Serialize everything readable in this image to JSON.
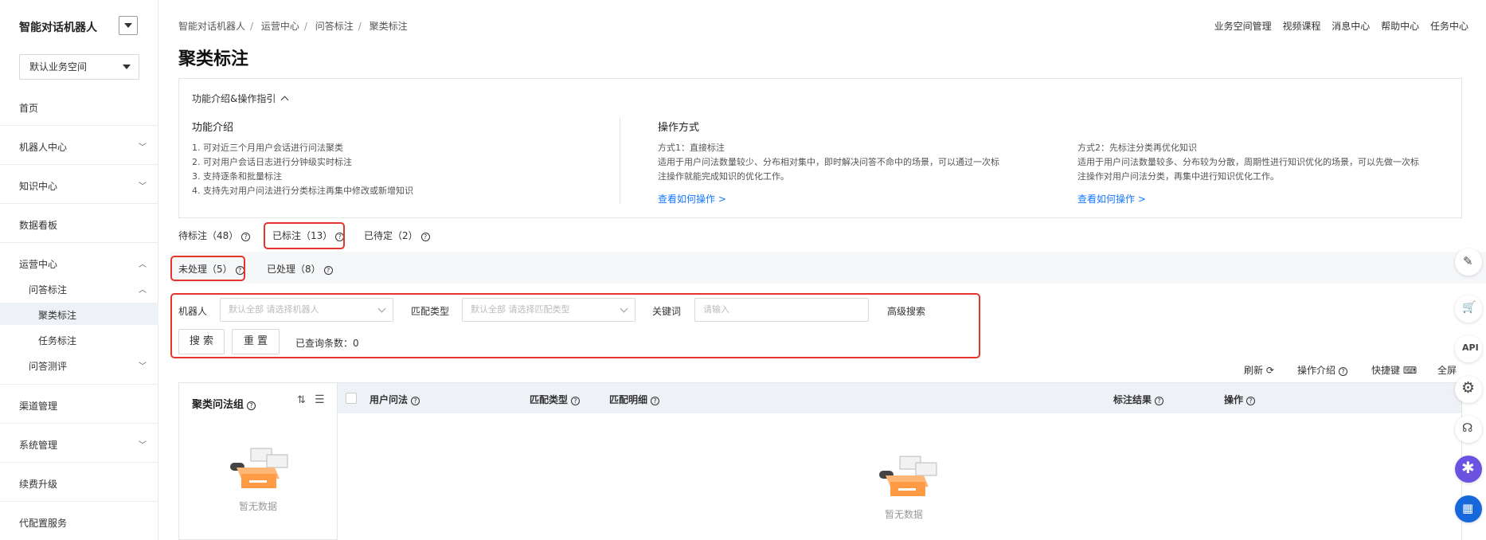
{
  "app": {
    "title": "智能对话机器人",
    "workspace": "默认业务空间"
  },
  "sidebar": {
    "items": [
      {
        "label": "首页"
      },
      {
        "label": "机器人中心"
      },
      {
        "label": "知识中心"
      },
      {
        "label": "数据看板"
      },
      {
        "label": "运营中心"
      },
      {
        "label": "问答标注"
      },
      {
        "label": "聚类标注"
      },
      {
        "label": "任务标注"
      },
      {
        "label": "问答测评"
      },
      {
        "label": "渠道管理"
      },
      {
        "label": "系统管理"
      },
      {
        "label": "续费升级"
      },
      {
        "label": "代配置服务"
      }
    ]
  },
  "breadcrumb": [
    "智能对话机器人",
    "运营中心",
    "问答标注",
    "聚类标注"
  ],
  "top_links": [
    "业务空间管理",
    "视频课程",
    "消息中心",
    "帮助中心",
    "任务中心"
  ],
  "page_title": "聚类标注",
  "intro": {
    "toggle_label": "功能介绍&操作指引",
    "features": {
      "title": "功能介绍",
      "lines": [
        "1. 可对近三个月用户会话进行问法聚类",
        "2. 可对用户会话日志进行分钟级实时标注",
        "3. 支持逐条和批量标注",
        "4. 支持先对用户问法进行分类标注再集中修改或新增知识"
      ]
    },
    "operations": {
      "title": "操作方式",
      "method1": {
        "title": "方式1：直接标注",
        "lines": [
          "适用于用户问法数量较少、分布相对集中，即时解决问答不命中的场景，可以通过一次标",
          "注操作就能完成知识的优化工作。"
        ],
        "link": "查看如何操作 >"
      },
      "method2": {
        "title": "方式2：先标注分类再优化知识",
        "lines": [
          "适用于用户问法数量较多、分布较为分散，周期性进行知识优化的场景，可以先做一次标",
          "注操作对用户问法分类，再集中进行知识优化工作。"
        ],
        "link": "查看如何操作 >"
      }
    }
  },
  "tabs": [
    {
      "label": "待标注（48）"
    },
    {
      "label": "已标注（13）"
    },
    {
      "label": "已待定（2）"
    }
  ],
  "subtabs": [
    {
      "label": "未处理（5）"
    },
    {
      "label": "已处理（8）"
    }
  ],
  "filter": {
    "robot_label": "机器人",
    "robot_placeholder": "默认全部 请选择机器人",
    "match_label": "匹配类型",
    "match_placeholder": "默认全部 请选择匹配类型",
    "keyword_label": "关键词",
    "keyword_placeholder": "请输入",
    "advanced": "高级搜索",
    "search_btn": "搜 索",
    "reset_btn": "重 置",
    "count_text": "已查询条数：0"
  },
  "toolbar": {
    "refresh": "刷新",
    "intro": "操作介绍",
    "shortcut": "快捷键",
    "fullscreen": "全屏"
  },
  "cluster": {
    "title": "聚类问法组",
    "empty": "暂无数据"
  },
  "table": {
    "columns": [
      "用户问法",
      "匹配类型",
      "匹配明细",
      "标注结果",
      "操作"
    ],
    "empty": "暂无数据"
  },
  "colors": {
    "accent": "#1677ff",
    "highlight": "#e5352b"
  }
}
